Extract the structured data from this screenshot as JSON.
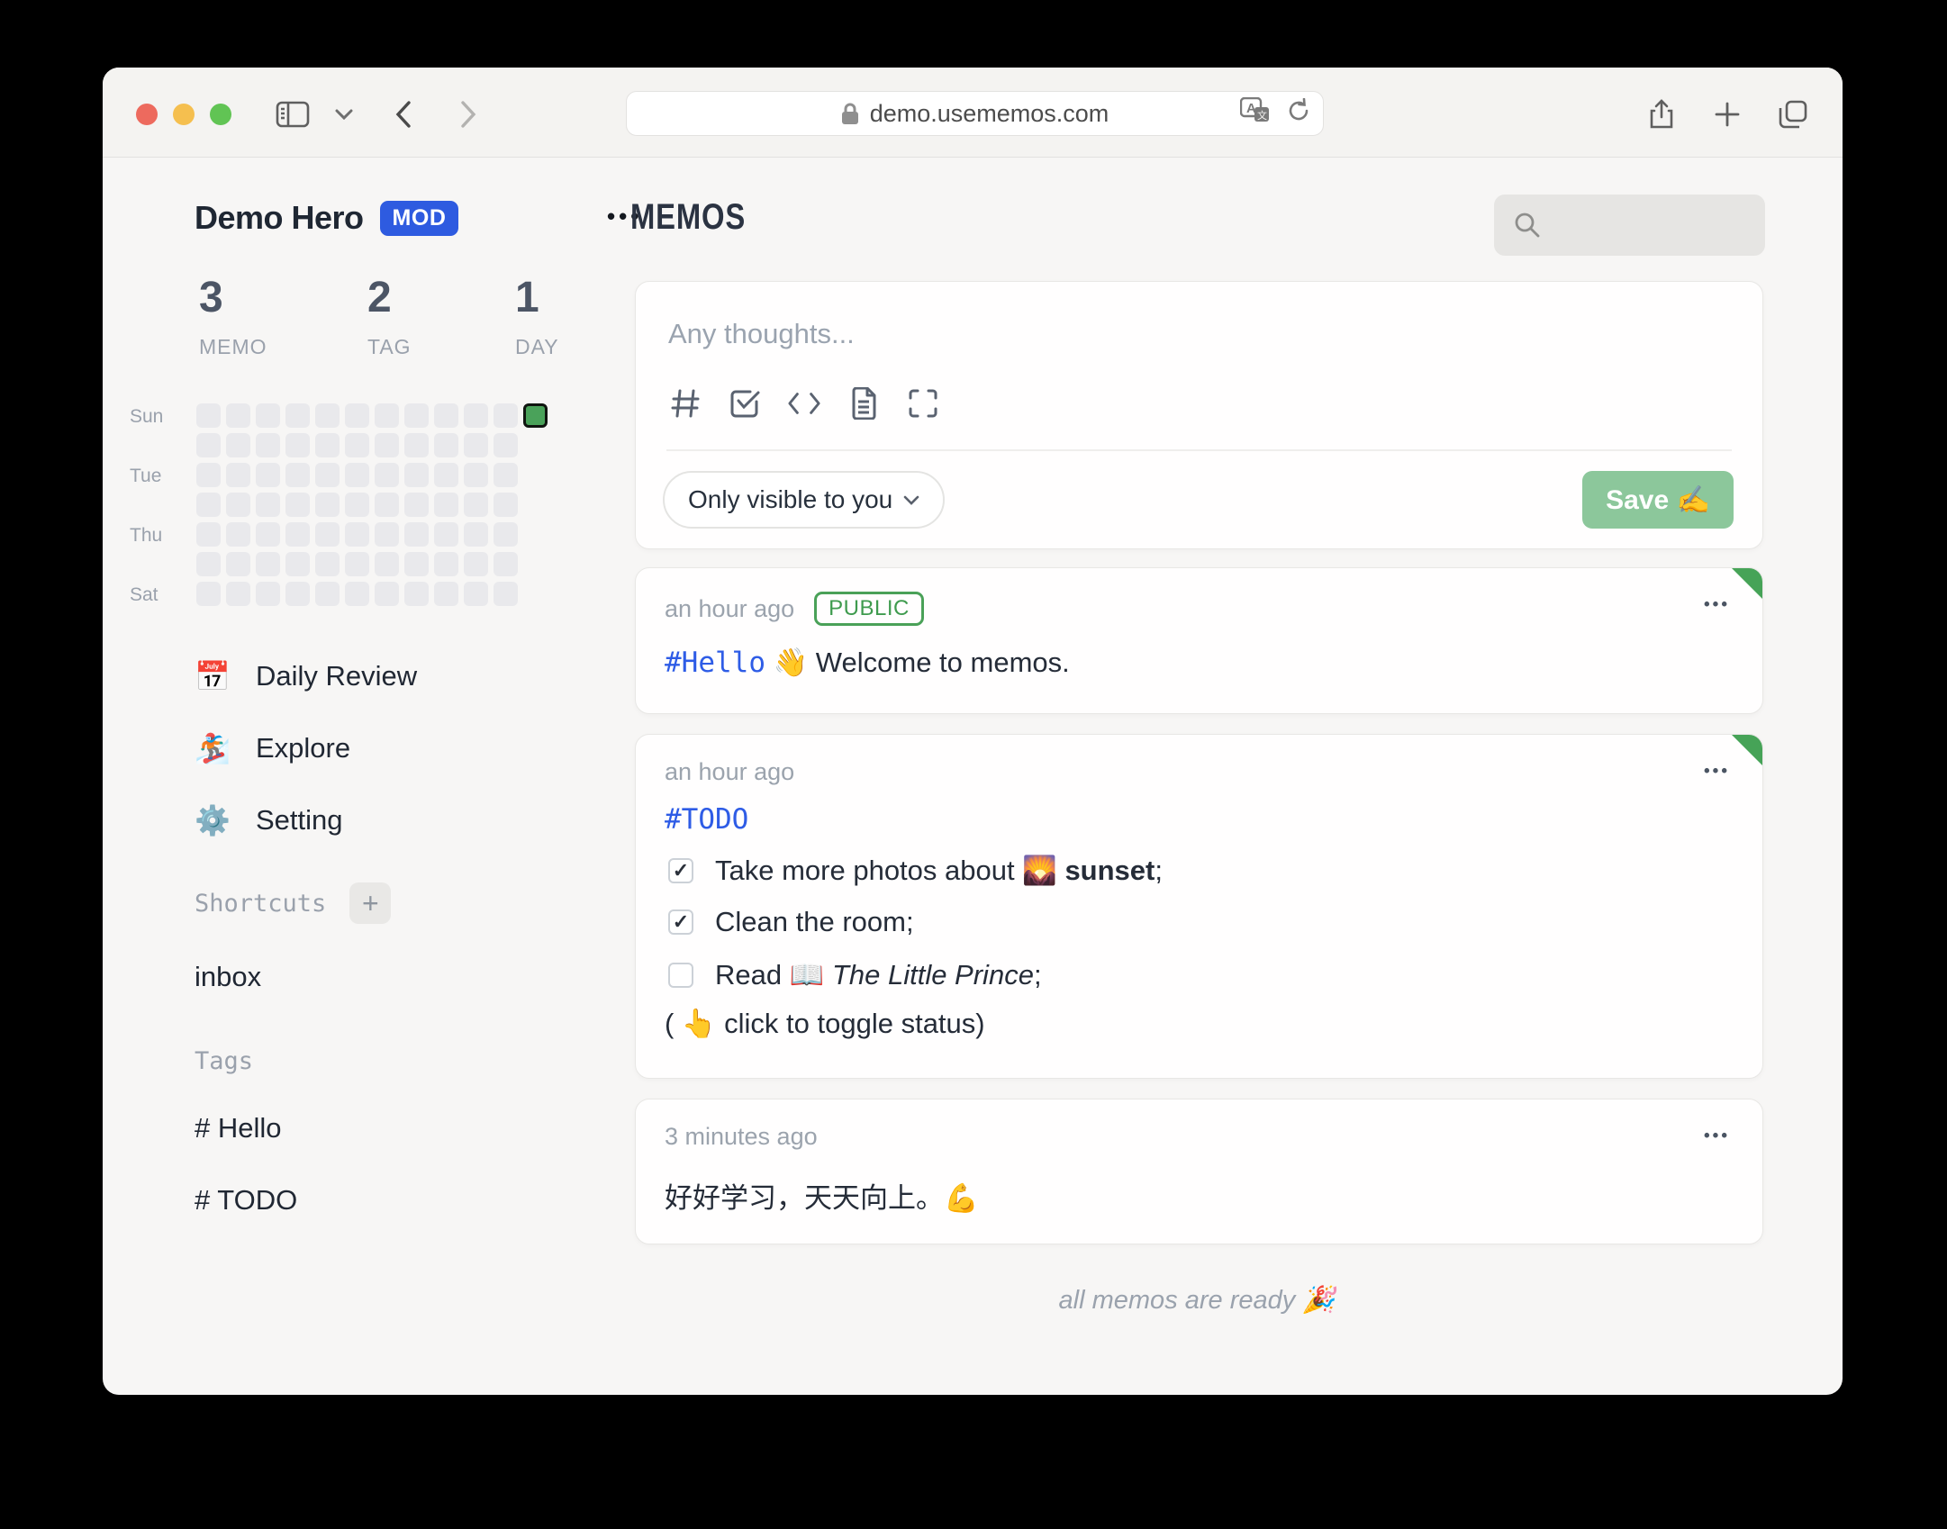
{
  "browser": {
    "url": "demo.usememos.com",
    "traffic_lights": [
      "close",
      "minimize",
      "fullscreen"
    ]
  },
  "sidebar": {
    "user": {
      "name": "Demo Hero",
      "badge": "MOD",
      "menu": "•••"
    },
    "stats": [
      {
        "value": "3",
        "label": "MEMO"
      },
      {
        "value": "2",
        "label": "TAG"
      },
      {
        "value": "1",
        "label": "DAY"
      }
    ],
    "heatmap": {
      "row_lengths": [
        12,
        11,
        11,
        11,
        11,
        11,
        11
      ],
      "active": {
        "row": 0,
        "col": 11
      },
      "day_labels": [
        {
          "text": "Sun",
          "row": 0
        },
        {
          "text": "Tue",
          "row": 2
        },
        {
          "text": "Thu",
          "row": 4
        },
        {
          "text": "Sat",
          "row": 6
        }
      ],
      "cell_color": "#e9e9ec",
      "active_color": "#4aa25a"
    },
    "nav": [
      {
        "icon": "📅",
        "label": "Daily Review"
      },
      {
        "icon": "🏂",
        "label": "Explore"
      },
      {
        "icon": "⚙️",
        "label": "Setting"
      }
    ],
    "shortcuts": {
      "label": "Shortcuts",
      "add_label": "+",
      "items": [
        "inbox"
      ]
    },
    "tags": {
      "label": "Tags",
      "items": [
        "# Hello",
        "# TODO"
      ]
    }
  },
  "main": {
    "title": "MEMOS",
    "composer": {
      "placeholder": "Any thoughts...",
      "visibility": "Only visible to you",
      "save_label": "Save ✍️"
    },
    "memos": [
      {
        "time": "an hour ago",
        "badge": "PUBLIC",
        "menu": "•••",
        "tag": "#Hello",
        "content": " 👋 Welcome to memos."
      },
      {
        "time": "an hour ago",
        "menu": "•••",
        "tag": "#TODO",
        "todos": [
          {
            "checked": true,
            "pre": "Take more photos about 🌄 ",
            "bold": "sunset",
            "post": ";"
          },
          {
            "checked": true,
            "pre": "Clean the room;"
          },
          {
            "checked": false,
            "pre": "Read 📖 ",
            "italic": "The Little Prince",
            "post": ";"
          }
        ],
        "note": "( 👆  click to toggle status)"
      },
      {
        "time": "3 minutes ago",
        "menu": "•••",
        "content": "好好学习，天天向上。💪"
      }
    ],
    "footer": "all memos are ready 🎉"
  }
}
